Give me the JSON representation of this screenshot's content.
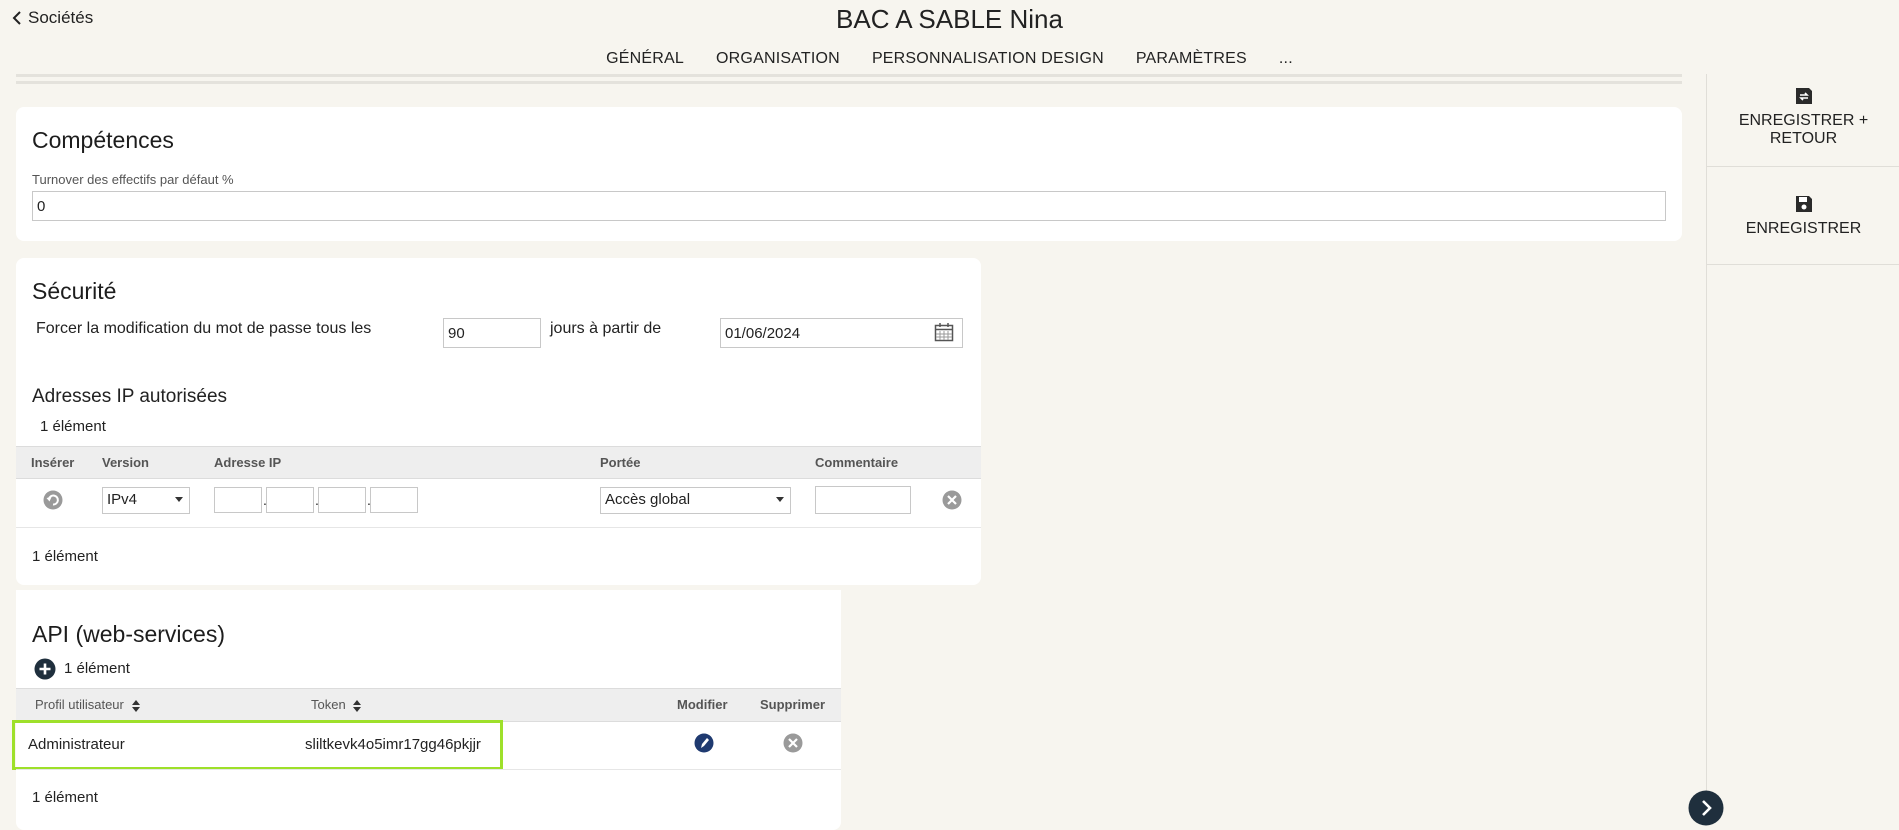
{
  "header": {
    "back_label": "Sociétés",
    "title": "BAC A SABLE Nina",
    "tabs": [
      {
        "label": "GÉNÉRAL",
        "active": false
      },
      {
        "label": "ORGANISATION",
        "active": false
      },
      {
        "label": "PERSONNALISATION DESIGN",
        "active": false
      },
      {
        "label": "PARAMÈTRES",
        "active": true
      },
      {
        "label": "...",
        "active": false
      }
    ]
  },
  "competences": {
    "title": "Compétences",
    "turnover_label": "Turnover des effectifs par défaut %",
    "turnover_value": "0"
  },
  "securite": {
    "title": "Sécurité",
    "force_label": "Forcer la modification du mot de passe tous les",
    "days_value": "90",
    "days_suffix": "jours à partir de",
    "date_value": "01/06/2024",
    "ip_section_title": "Adresses IP autorisées",
    "ip_count_top": "1 élément",
    "ip_columns": [
      "Insérer",
      "Version",
      "Adresse IP",
      "Portée",
      "Commentaire"
    ],
    "ip_row": {
      "version": "IPv4",
      "portee": "Accès global",
      "commentaire": ""
    },
    "ip_count_bottom": "1 élément"
  },
  "api": {
    "title": "API (web-services)",
    "count_top": "1 élément",
    "columns": [
      "Profil utilisateur",
      "Token",
      "Modifier",
      "Supprimer"
    ],
    "rows": [
      {
        "profil": "Administrateur",
        "token": "sliltkevk4o5imr17gg46pkjjr"
      }
    ],
    "count_bottom": "1 élément"
  },
  "side_panel": {
    "save_return_label_1": "ENREGISTRER +",
    "save_return_label_2": "RETOUR",
    "save_label": "ENREGISTRER"
  },
  "colors": {
    "accent": "#1f4256",
    "highlight": "#9ee02a",
    "background": "#f7f5ef"
  }
}
